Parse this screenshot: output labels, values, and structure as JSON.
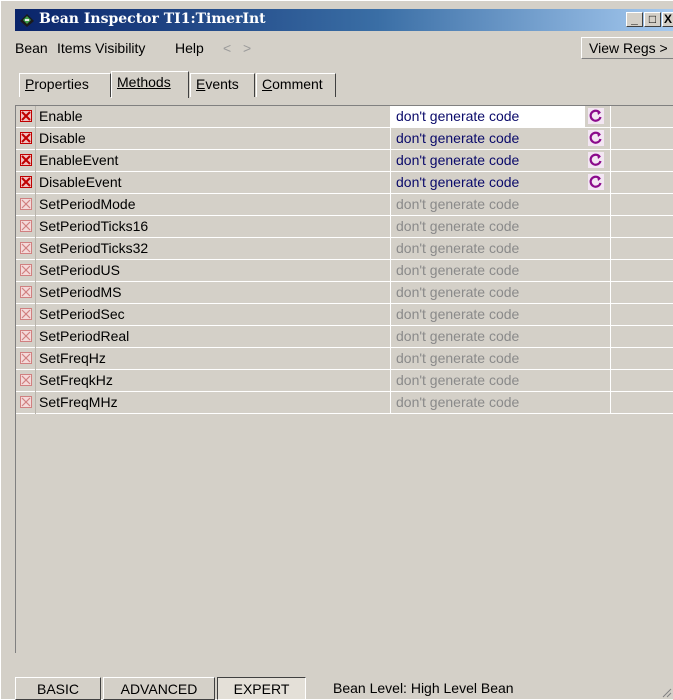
{
  "window": {
    "title": "Bean Inspector TI1:TimerInt",
    "controls": {
      "minimize": "_",
      "maximize": "□",
      "close": "X"
    }
  },
  "menubar": {
    "items": [
      "Bean",
      "Items Visibility",
      "Help",
      "<",
      ">"
    ],
    "view_regs": "View Regs >"
  },
  "tabs": [
    {
      "label": "Properties",
      "active": false
    },
    {
      "label": "Methods",
      "active": true
    },
    {
      "label": "Events",
      "active": false
    },
    {
      "label": "Comment",
      "active": false
    }
  ],
  "methods": [
    {
      "name": "Enable",
      "value": "don't generate code",
      "enabled": true
    },
    {
      "name": "Disable",
      "value": "don't generate code",
      "enabled": true
    },
    {
      "name": "EnableEvent",
      "value": "don't generate code",
      "enabled": true
    },
    {
      "name": "DisableEvent",
      "value": "don't generate code",
      "enabled": true
    },
    {
      "name": "SetPeriodMode",
      "value": "don't generate code",
      "enabled": false
    },
    {
      "name": "SetPeriodTicks16",
      "value": "don't generate code",
      "enabled": false
    },
    {
      "name": "SetPeriodTicks32",
      "value": "don't generate code",
      "enabled": false
    },
    {
      "name": "SetPeriodUS",
      "value": "don't generate code",
      "enabled": false
    },
    {
      "name": "SetPeriodMS",
      "value": "don't generate code",
      "enabled": false
    },
    {
      "name": "SetPeriodSec",
      "value": "don't generate code",
      "enabled": false
    },
    {
      "name": "SetPeriodReal",
      "value": "don't generate code",
      "enabled": false
    },
    {
      "name": "SetFreqHz",
      "value": "don't generate code",
      "enabled": false
    },
    {
      "name": "SetFreqkHz",
      "value": "don't generate code",
      "enabled": false
    },
    {
      "name": "SetFreqMHz",
      "value": "don't generate code",
      "enabled": false
    }
  ],
  "bottombar": {
    "levels": [
      "BASIC",
      "ADVANCED",
      "EXPERT"
    ],
    "pressed_level": "EXPERT",
    "level_info": "Bean Level: High Level Bean"
  },
  "colors": {
    "title_gradient_start": "#0a246a",
    "title_gradient_end": "#a6caf0",
    "enabled_value_text": "#0a0a6a",
    "disabled_value_text": "#8a8a8a",
    "method_icon_red": "#c00000",
    "refresh_icon_purple": "#8b0a8b"
  }
}
